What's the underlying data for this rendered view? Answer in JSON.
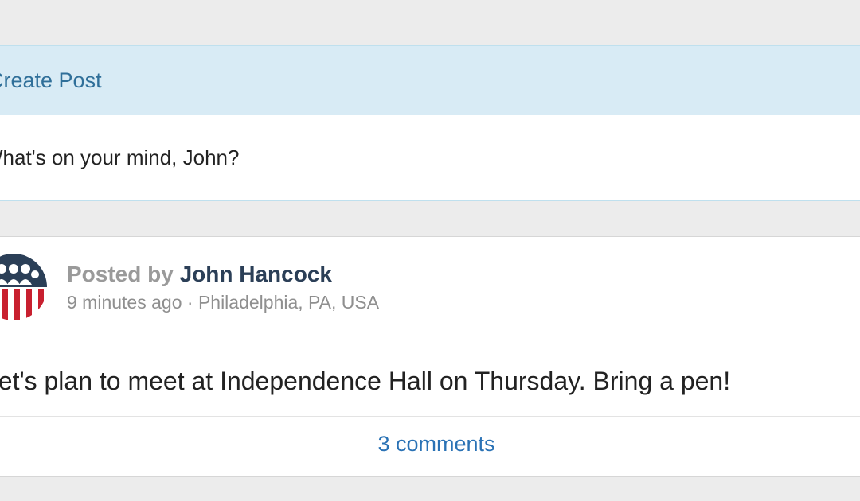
{
  "create_post": {
    "title": "Create Post",
    "placeholder": "What's on your mind, John?"
  },
  "post": {
    "posted_by_label": "Posted by",
    "author": "John Hancock",
    "time": "9 minutes ago",
    "separator": "·",
    "location": "Philadelphia, PA, USA",
    "text": "Let's plan to meet at Independence Hall on Thursday. Bring a pen!",
    "comments_link": "3 comments"
  },
  "colors": {
    "header_bg": "#d8ebf5",
    "link_blue": "#2a72b5",
    "author_navy": "#2b3f57",
    "avatar_red": "#c8202f"
  }
}
